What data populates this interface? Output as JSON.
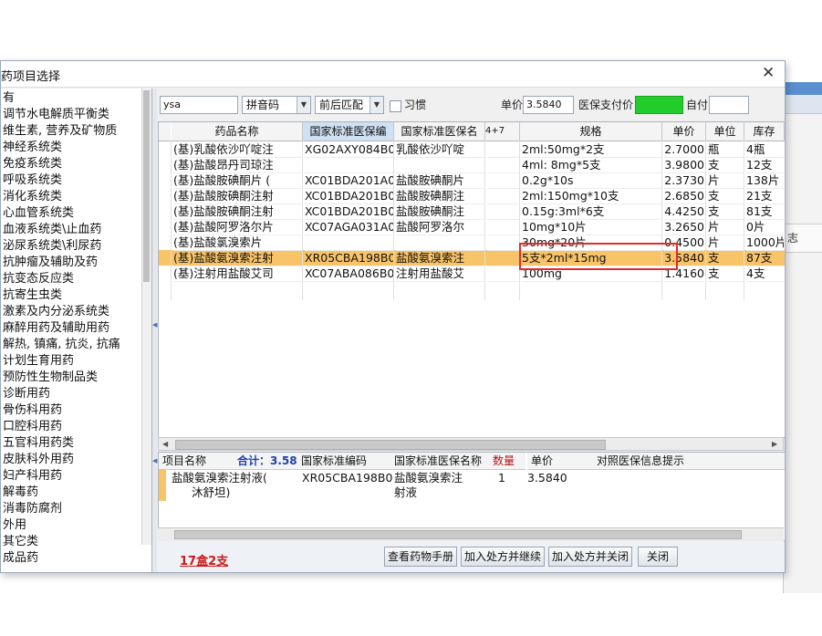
{
  "window": {
    "title": "药项目选择",
    "close_glyph": "✕"
  },
  "background_app": {
    "partial_text": "志"
  },
  "tree": {
    "items": [
      "有",
      "调节水电解质平衡类",
      "维生素, 营养及矿物质",
      "神经系统类",
      "免疫系统类",
      "呼吸系统类",
      "消化系统类",
      "心血管系统类",
      "血液系统类\\止血药",
      "泌尿系统类\\利尿药",
      "抗肿瘤及辅助及药",
      "抗变态反应类",
      "抗寄生虫类",
      "激素及内分泌系统类",
      "麻醉用药及辅助用药",
      "解热, 镇痛, 抗炎, 抗痛",
      "计划生育用药",
      "预防性生物制品类",
      "诊断用药",
      "骨伤科用药",
      "口腔科用药",
      "五官科用药类",
      "皮肤科外用药",
      "妇产科用药",
      "解毒药",
      "消毒防腐剂",
      "外用",
      "其它类",
      "成品药"
    ]
  },
  "toolbar": {
    "search_value": "ysa",
    "input_mode": "拼音码",
    "match_mode": "前后匹配",
    "habit_label": "习惯",
    "price_label": "单价",
    "price_value": "3.5840",
    "insurance_price_label": "医保支付价",
    "insurance_color": "#22cc2a",
    "self_pay_label": "自付"
  },
  "grid": {
    "headers": [
      "药品名称",
      "国家标准医保编",
      "国家标准医保名",
      "4+7",
      "规格",
      "单价",
      "单位",
      "库存"
    ],
    "rows": [
      [
        "(基)乳酸依沙吖啶注",
        "XG02AXY084B0",
        "乳酸依沙吖啶",
        "",
        "2ml:50mg*2支",
        "2.7000",
        "瓶",
        "4瓶"
      ],
      [
        "(基)盐酸昂丹司琼注",
        "",
        "",
        "",
        "4ml: 8mg*5支",
        "3.9800",
        "支",
        "12支"
      ],
      [
        "(基)盐酸胺碘酮片 (",
        "XC01BDA201A0",
        "盐酸胺碘酮片",
        "",
        "0.2g*10s",
        "2.3730",
        "片",
        "138片"
      ],
      [
        "(基)盐酸胺碘酮注射",
        "XC01BDA201B0",
        "盐酸胺碘酮注",
        "",
        "2ml:150mg*10支",
        "2.6850",
        "支",
        "21支"
      ],
      [
        "(基)盐酸胺碘酮注射",
        "XC01BDA201B0",
        "盐酸胺碘酮注",
        "",
        "0.15g:3ml*6支",
        "4.4250",
        "支",
        "81支"
      ],
      [
        "(基)盐酸阿罗洛尔片",
        "XC07AGA031A0",
        "盐酸阿罗洛尔",
        "",
        "10mg*10片",
        "3.2650",
        "片",
        "0片"
      ],
      [
        "(基)盐酸氯溴索片",
        "",
        "",
        "",
        "30mg*20片",
        "0.4500",
        "片",
        "1000片"
      ],
      [
        "(基)盐酸氨溴索注射",
        "XR05CBA198B0",
        "盐酸氨溴索注",
        "",
        "5支*2ml*15mg",
        "3.5840",
        "支",
        "87支"
      ],
      [
        "(基)注射用盐酸艾司",
        "XC07ABA086B0",
        "注射用盐酸艾",
        "",
        "100mg",
        "1.4160",
        "支",
        "4支"
      ]
    ],
    "highlight_color": "#e22b2b",
    "selected_color": "#f9c468"
  },
  "bottom": {
    "headers": [
      "项目名称",
      "合计：3.5840",
      "国家标准编码",
      "国家标准医保名称",
      "数量",
      "单价",
      "对照医保信息提示"
    ],
    "row": {
      "name_line1": "盐酸氨溴索注射液(",
      "name_line2": "沐舒坦)",
      "code": "XR05CBA198B0",
      "ins_name_line1": "盐酸氨溴索注",
      "ins_name_line2": "射液",
      "qty": "1",
      "price": "3.5840"
    }
  },
  "footer": {
    "summary": "17盒2支",
    "buttons": [
      "查看药物手册",
      "加入处方并继续",
      "加入处方并关闭",
      "关闭"
    ]
  }
}
